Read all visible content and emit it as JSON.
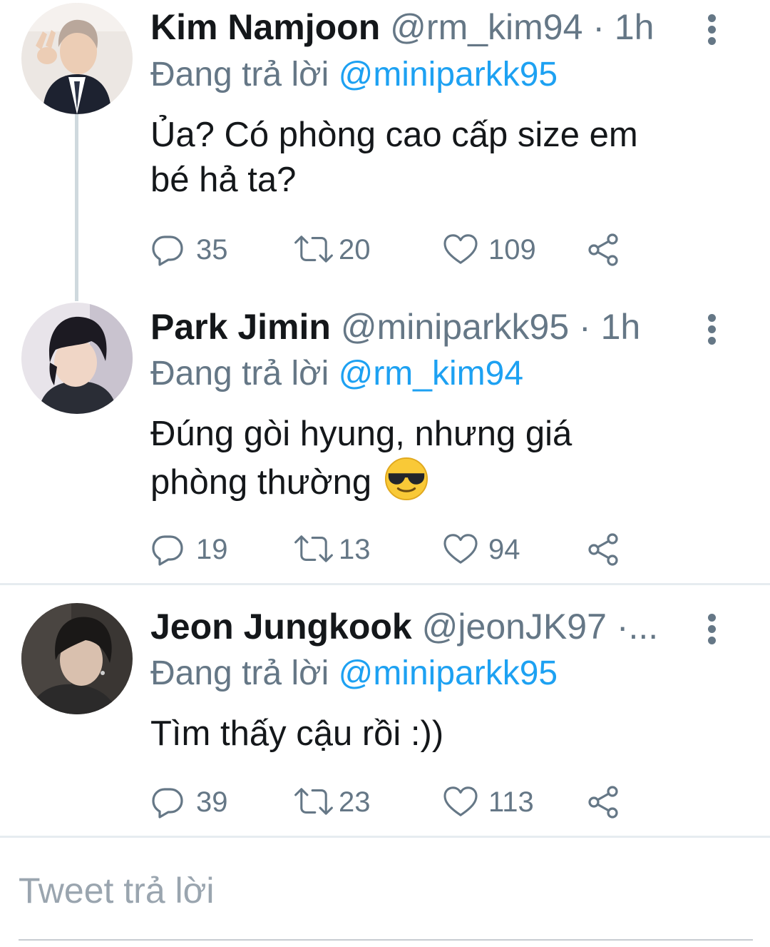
{
  "tweets": [
    {
      "name": "Kim Namjoon",
      "handle": "@rm_kim94",
      "sep": "·",
      "time": "1h",
      "reply_prefix": "Đang trả lời",
      "reply_to": "@miniparkk95",
      "text_line1": "Ủa? Có phòng cao cấp size em",
      "text_line2": "bé hả ta?",
      "replies": "35",
      "retweets": "20",
      "likes": "109",
      "avatar_icon": "person-photo-icon"
    },
    {
      "name": "Park Jimin",
      "handle": "@miniparkk95",
      "sep": "·",
      "time": "1h",
      "reply_prefix": "Đang trả lời",
      "reply_to": "@rm_kim94",
      "text_line1": "Đúng gòi hyung, nhưng giá",
      "text_line2": "phòng thường",
      "emoji": "smiling-face-with-sunglasses",
      "replies": "19",
      "retweets": "13",
      "likes": "94",
      "avatar_icon": "person-photo-icon"
    },
    {
      "name": "Jeon Jungkook",
      "handle": "@jeonJK97",
      "sep": "·...",
      "reply_prefix": "Đang trả lời",
      "reply_to": "@miniparkk95",
      "text_line1": "Tìm thấy cậu rồi :))",
      "replies": "39",
      "retweets": "23",
      "likes": "113",
      "avatar_icon": "person-photo-icon"
    }
  ],
  "reply_input": {
    "placeholder": "Tweet trả lời"
  },
  "colors": {
    "text": "#14171a",
    "secondary": "#657786",
    "link": "#1da1f2",
    "divider": "#e6ecf0"
  },
  "icons": [
    "reply-icon",
    "retweet-icon",
    "like-icon",
    "share-icon",
    "more-options-icon"
  ]
}
